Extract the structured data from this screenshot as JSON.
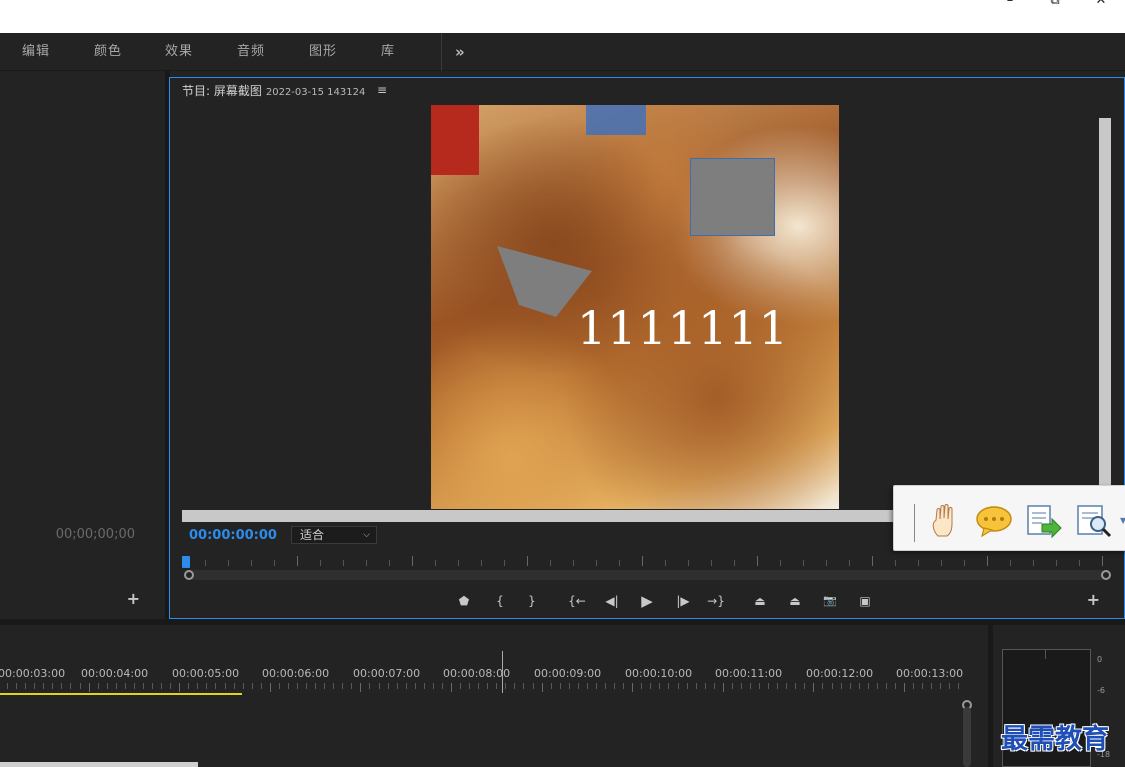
{
  "window": {
    "minimize_glyph": "–",
    "restore_glyph": "⧉",
    "close_glyph": "✕"
  },
  "workspace_tabs": [
    {
      "label": "编辑"
    },
    {
      "label": "颜色"
    },
    {
      "label": "效果"
    },
    {
      "label": "音频"
    },
    {
      "label": "图形"
    },
    {
      "label": "库"
    }
  ],
  "workspace_more": "»",
  "source_panel": {
    "timecode": "00;00;00;00",
    "add_label": "+"
  },
  "program_monitor": {
    "title": "节目: 屏幕截图",
    "sequence_name": "2022-03-15 143124",
    "menu_glyph": "≡",
    "overlay_text": "1111111",
    "current_timecode": "00:00:00:00",
    "fit_value": "适合",
    "fit_chevron": "⌵",
    "add_label": "+",
    "transport": [
      {
        "name": "marker-icon",
        "glyph": "⬟"
      },
      {
        "name": "mark-in-icon",
        "glyph": "{"
      },
      {
        "name": "mark-out-icon",
        "glyph": "}"
      },
      {
        "name": "go-to-in-icon",
        "glyph": "{←"
      },
      {
        "name": "step-back-icon",
        "glyph": "◀|"
      },
      {
        "name": "play-icon",
        "glyph": "▶"
      },
      {
        "name": "step-forward-icon",
        "glyph": "|▶"
      },
      {
        "name": "go-to-out-icon",
        "glyph": "→}"
      },
      {
        "name": "lift-icon",
        "glyph": "⏏"
      },
      {
        "name": "extract-icon",
        "glyph": "⏏"
      },
      {
        "name": "export-frame-icon",
        "glyph": "📷"
      },
      {
        "name": "compare-icon",
        "glyph": "▣"
      }
    ]
  },
  "floating_toolbar": {
    "items": [
      {
        "name": "hand-tool-icon"
      },
      {
        "name": "comment-icon"
      },
      {
        "name": "export-doc-icon"
      },
      {
        "name": "find-doc-icon"
      }
    ]
  },
  "timeline": {
    "labels": [
      "00:00:03:00",
      "00:00:04:00",
      "00:00:05:00",
      "00:00:06:00",
      "00:00:07:00",
      "00:00:08:00",
      "00:00:09:00",
      "00:00:10:00",
      "00:00:11:00",
      "00:00:12:00",
      "00:00:13:00"
    ]
  },
  "audio_meter": {
    "scale": [
      "0",
      "-6",
      "-18"
    ]
  },
  "watermark": "最需教育",
  "colors": {
    "accent": "#2d8ceb",
    "work_area_bar": "#e2d21e",
    "watermark": "#1f4fb6"
  }
}
